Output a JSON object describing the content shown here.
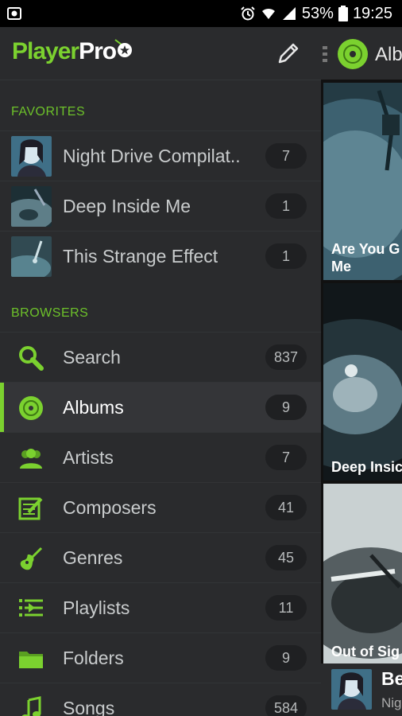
{
  "status_bar": {
    "battery": "53%",
    "time": "19:25"
  },
  "drawer": {
    "logo": {
      "player": "Player",
      "pro": "Pro"
    },
    "favorites_title": "FAVORITES",
    "favorites": [
      {
        "label": "Night Drive Compilat..",
        "count": "7"
      },
      {
        "label": "Deep Inside Me",
        "count": "1"
      },
      {
        "label": "This Strange Effect",
        "count": "1"
      }
    ],
    "browsers_title": "BROWSERS",
    "browsers": [
      {
        "label": "Search",
        "count": "837",
        "icon": "search-icon"
      },
      {
        "label": "Albums",
        "count": "9",
        "icon": "album-disc-icon",
        "active": true
      },
      {
        "label": "Artists",
        "count": "7",
        "icon": "artists-icon"
      },
      {
        "label": "Composers",
        "count": "41",
        "icon": "composers-icon"
      },
      {
        "label": "Genres",
        "count": "45",
        "icon": "guitar-icon"
      },
      {
        "label": "Playlists",
        "count": "11",
        "icon": "playlist-icon"
      },
      {
        "label": "Folders",
        "count": "9",
        "icon": "folder-icon"
      },
      {
        "label": "Songs",
        "count": "584",
        "icon": "music-note-icon"
      }
    ]
  },
  "main": {
    "title": "Alb",
    "tiles": [
      {
        "caption_line1": "Are You G",
        "caption_line2": "Me"
      },
      {
        "caption_line1": "Deep Insic",
        "caption_line2": ""
      },
      {
        "caption_line1": "Out of Sig",
        "caption_line2": ""
      }
    ]
  },
  "now_playing": {
    "title": "Be",
    "subtitle": "Nig"
  },
  "colors": {
    "accent": "#7bd12f",
    "drawer_bg": "#2a2b2d",
    "section_title": "#6dc12a"
  }
}
